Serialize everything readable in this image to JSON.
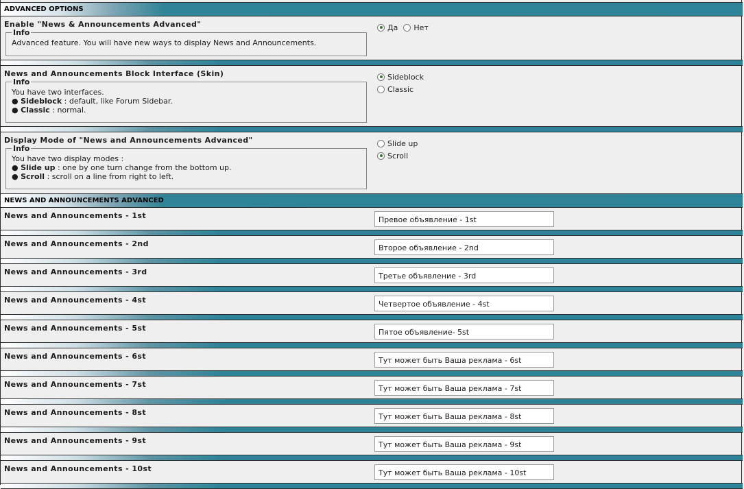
{
  "advanced": {
    "header": "ADVANCED OPTIONS",
    "enable": {
      "title": "Enable \"News & Announcements Advanced\"",
      "legend": "Info",
      "text": "Advanced feature. You will have new ways to display News and Announcements.",
      "options": [
        {
          "label": "Да",
          "checked": true
        },
        {
          "label": "Нет",
          "checked": false
        }
      ]
    },
    "skin": {
      "title": "News and Announcements Block Interface (Skin)",
      "legend": "Info",
      "intro": "You have two interfaces.",
      "items": [
        {
          "bullet": "●",
          "name": "Sideblock",
          "desc": " : default, like Forum Sidebar."
        },
        {
          "bullet": "●",
          "name": "Classic",
          "desc": " : normal."
        }
      ],
      "options": [
        {
          "label": "Sideblock",
          "checked": true
        },
        {
          "label": "Classic",
          "checked": false
        }
      ]
    },
    "mode": {
      "title": "Display Mode of \"News and Announcements Advanced\"",
      "legend": "Info",
      "intro": "You have two display modes :",
      "items": [
        {
          "bullet": "●",
          "name": "Slide up",
          "desc": " : one by one turn change from the bottom up."
        },
        {
          "bullet": "●",
          "name": "Scroll",
          "desc": " : scroll on a line from right to left."
        }
      ],
      "options": [
        {
          "label": "Slide up",
          "checked": false
        },
        {
          "label": "Scroll",
          "checked": true
        }
      ]
    }
  },
  "news": {
    "header": "NEWS AND ANNOUNCEMENTS ADVANCED",
    "rows": [
      {
        "label": "News and Announcements - 1st",
        "value": "Превое объявление - 1st"
      },
      {
        "label": "News and Announcements - 2nd",
        "value": "Второе объявление - 2nd"
      },
      {
        "label": "News and Announcements - 3rd",
        "value": "Третье объявление - 3rd"
      },
      {
        "label": "News and Announcements - 4st",
        "value": "Четвертое объявление - 4st"
      },
      {
        "label": "News and Announcements - 5st",
        "value": "Пятое объявление- 5st"
      },
      {
        "label": "News and Announcements - 6st",
        "value": "Тут может быть Ваша реклама - 6st"
      },
      {
        "label": "News and Announcements - 7st",
        "value": "Тут может быть Ваша реклама - 7st"
      },
      {
        "label": "News and Announcements - 8st",
        "value": "Тут может быть Ваша реклама - 8st"
      },
      {
        "label": "News and Announcements - 9st",
        "value": "Тут может быть Ваша реклама - 9st"
      },
      {
        "label": "News and Announcements - 10st",
        "value": "Тут может быть Ваша реклама - 10st"
      }
    ]
  }
}
